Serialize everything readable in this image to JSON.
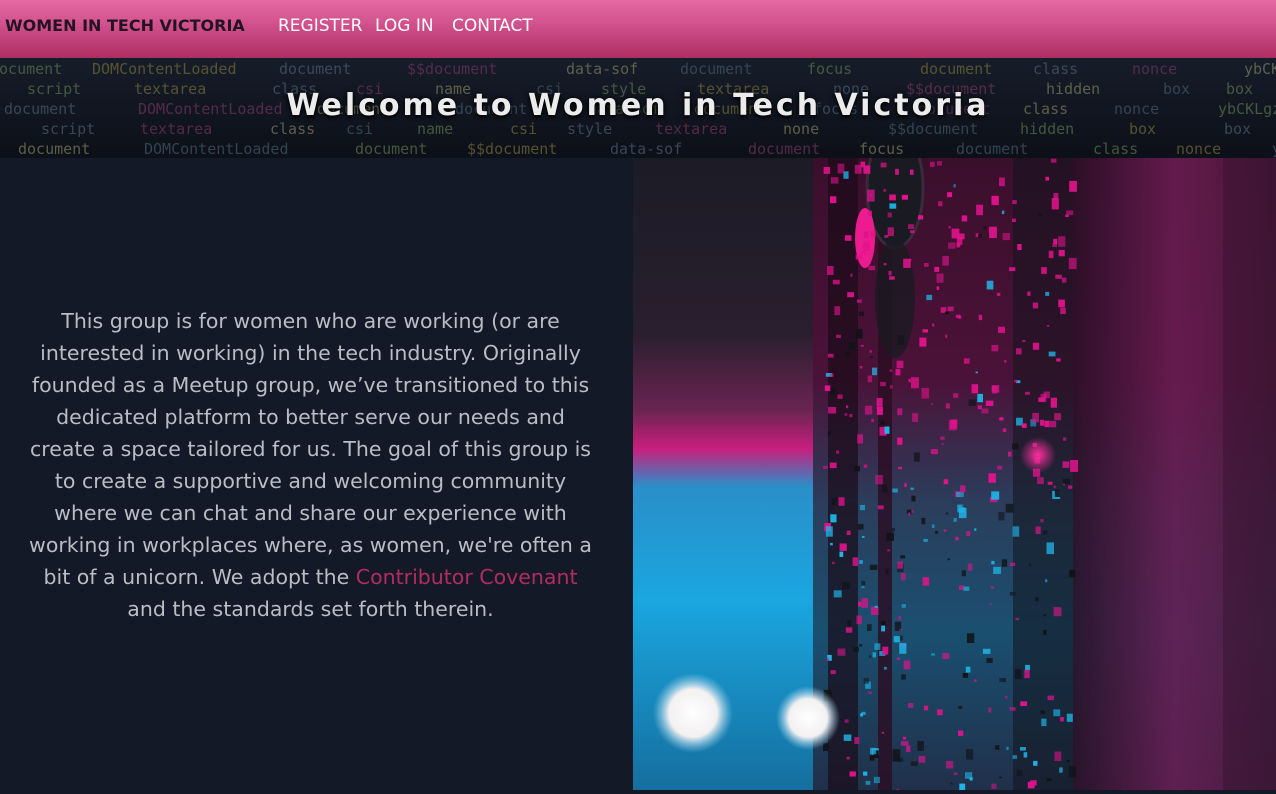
{
  "navbar": {
    "brand": "WOMEN IN TECH VICTORIA",
    "links": [
      "REGISTER",
      "LOG IN",
      "CONTACT"
    ]
  },
  "hero": {
    "title": "Welcome to Women in Tech Victoria",
    "background_code_text": [
      "document",
      "DOMContentLoaded",
      "document",
      "$$document",
      "data-sof",
      "document",
      "focus",
      "document",
      "class",
      "nonce",
      "ybCKLgzoG",
      "script",
      "textarea",
      "class",
      "csi",
      "name",
      "csi",
      "style",
      "textarea",
      "none",
      "$$document",
      "hidden",
      "box",
      "box"
    ]
  },
  "intro": {
    "text_before_link": "This group is for women who are working (or are interested in working) in the tech industry. Originally founded as a Meetup group, we’ve transitioned to this dedicated platform to better serve our needs and create a space tailored for us. The goal of this group is to create a supportive and welcoming community where we can chat and share our experience with working in workplaces where, as women, we're often a bit of a unicorn. We adopt the ",
    "link_text": "Contributor Covenant",
    "text_after_link": " and the standards set forth therein."
  },
  "colors": {
    "navbar_top": "#e66aa4",
    "navbar_bottom": "#ad2e63",
    "page_background": "#141927",
    "body_text": "#b8bdc6",
    "link": "#b32b63",
    "brand_text": "#231323"
  },
  "image": {
    "subject": "circuit-board-photo",
    "palette": [
      "#e0138c",
      "#1fb6e8",
      "#2a1a2e",
      "#f2f0f0"
    ]
  }
}
